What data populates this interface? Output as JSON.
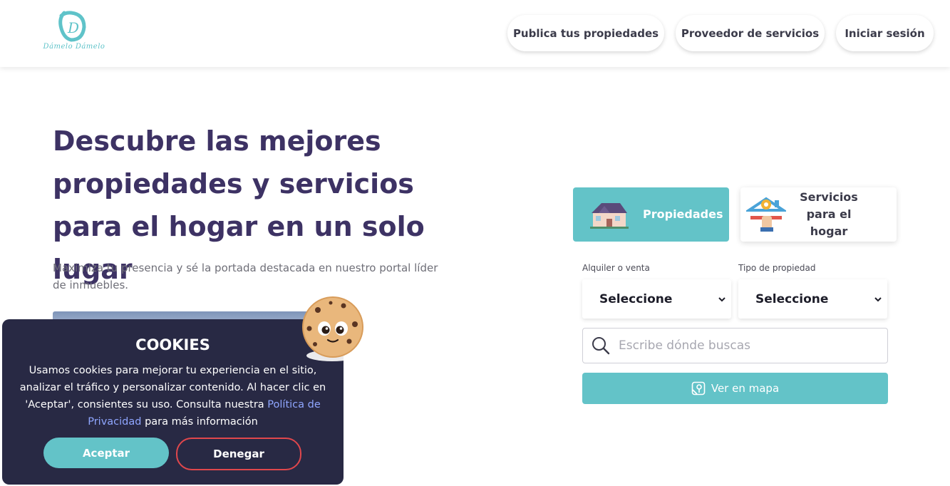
{
  "brand": {
    "logo_letter": "D",
    "logo_text": "Dámelo Dámelo",
    "accent_color": "#63c3c8",
    "title_color": "#3d3264"
  },
  "header": {
    "nav": [
      {
        "label": "Publica tus propiedades"
      },
      {
        "label": "Proveedor de servicios"
      },
      {
        "label": "Iniciar sesión"
      }
    ]
  },
  "hero": {
    "title": "Descubre las mejores propiedades y servicios para el hogar en un solo lugar",
    "subtitle": "Maximiza tu presencia y sé la portada destacada en nuestro portal líder de inmuebles."
  },
  "search": {
    "tabs": [
      {
        "label": "Propiedades",
        "icon": "house-icon",
        "active": true
      },
      {
        "label": "Servicios para el hogar",
        "icon": "repair-tools-icon",
        "active": false
      }
    ],
    "rent_or_sale": {
      "label": "Alquiler o venta",
      "value": "Seleccione"
    },
    "property_type": {
      "label": "Tipo de propiedad",
      "value": "Seleccione"
    },
    "location": {
      "placeholder": "Escribe dónde buscas",
      "value": ""
    },
    "map_button": {
      "label": "Ver en mapa",
      "icon": "map-pin-icon"
    }
  },
  "cookies": {
    "title": "COOKIES",
    "text_before_link": "Usamos cookies para mejorar tu experiencia en el sitio, analizar el tráfico y personalizar contenido. Al hacer clic en 'Aceptar', consientes su uso. Consulta nuestra ",
    "link_label": "Política de Privacidad",
    "text_after_link": " para más información",
    "accept_label": "Aceptar",
    "deny_label": "Denegar",
    "link_color": "#8fa6ff",
    "deny_border_color": "#e0474c"
  }
}
